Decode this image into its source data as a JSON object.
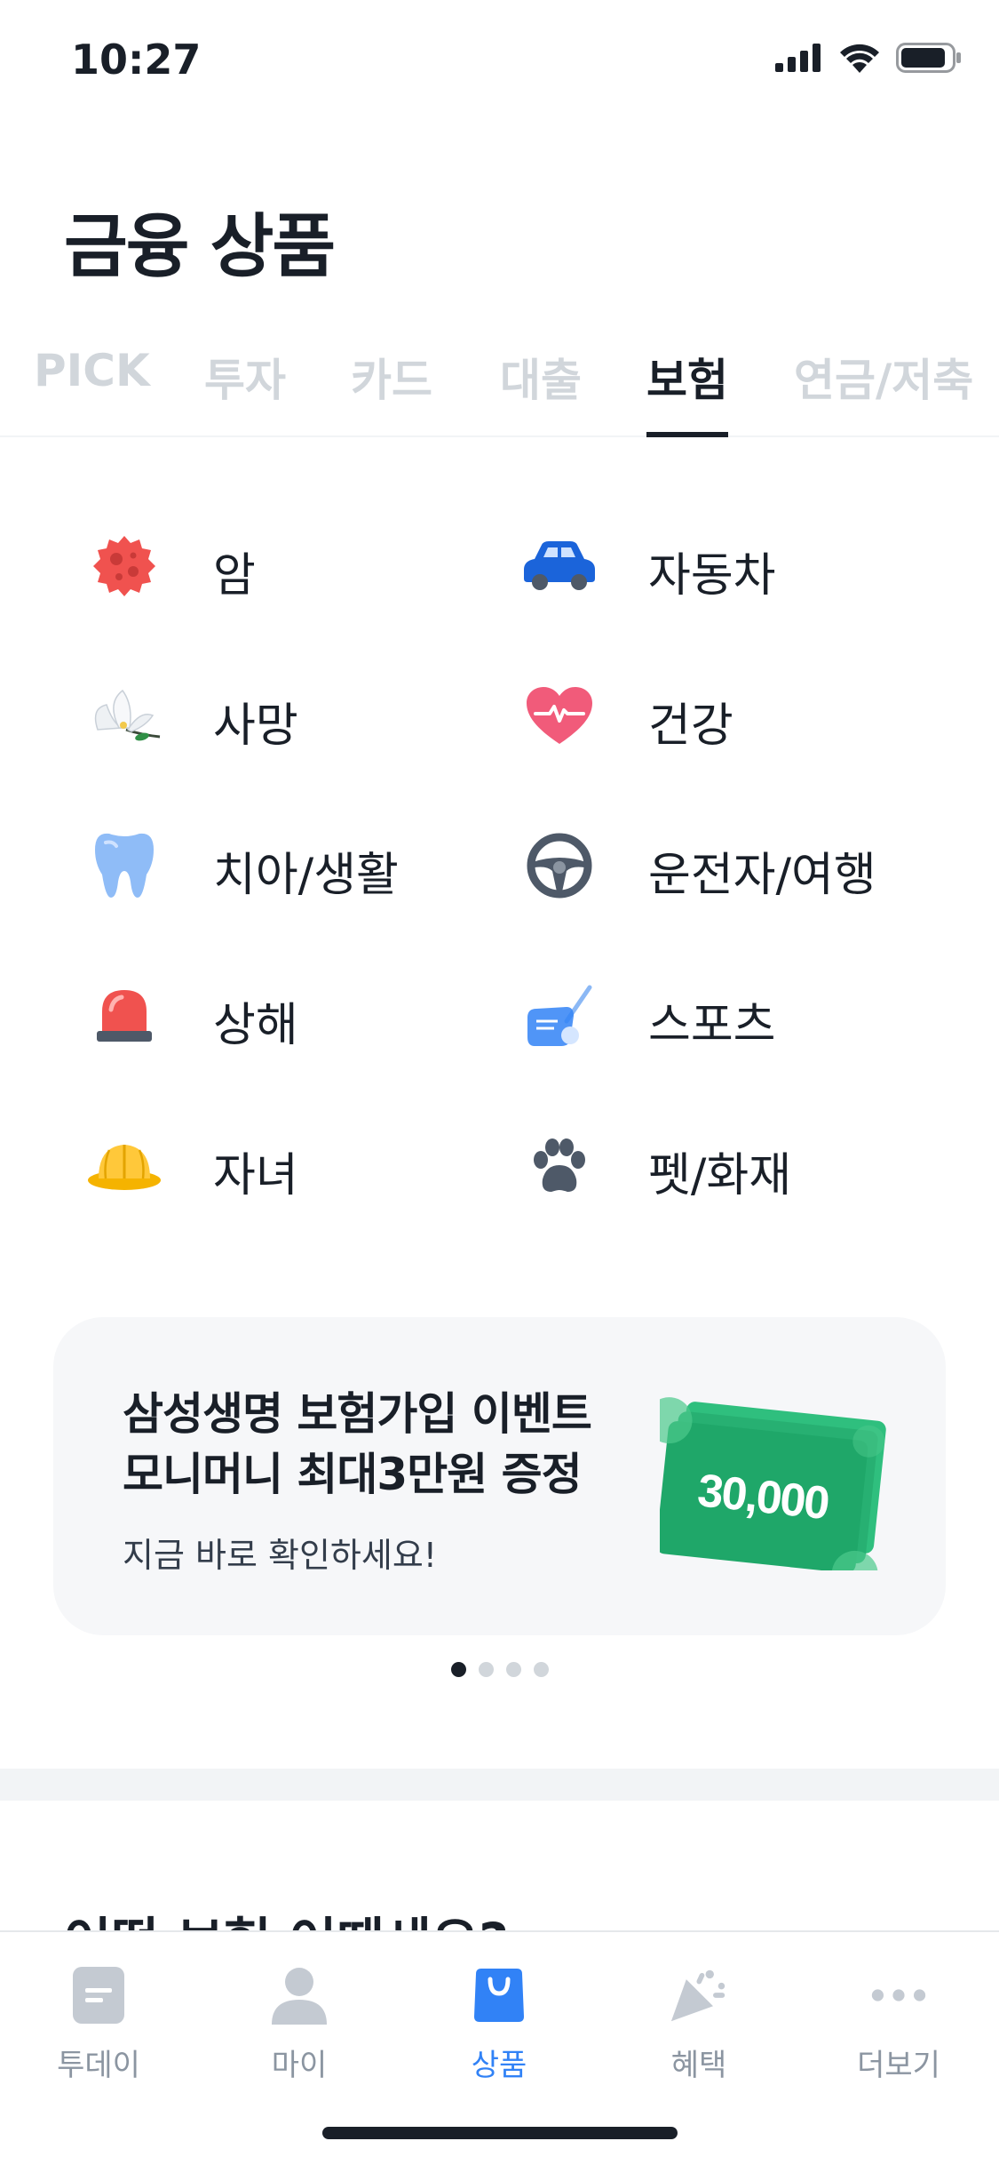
{
  "status": {
    "time": "10:27"
  },
  "page": {
    "title": "금융 상품"
  },
  "tabs": [
    {
      "label": "PICK"
    },
    {
      "label": "투자"
    },
    {
      "label": "카드"
    },
    {
      "label": "대출"
    },
    {
      "label": "보험"
    },
    {
      "label": "연금/저축"
    }
  ],
  "active_tab": "보험",
  "categories": [
    {
      "label": "암",
      "icon": "cancer-cell-icon"
    },
    {
      "label": "자동차",
      "icon": "car-icon"
    },
    {
      "label": "사망",
      "icon": "white-flower-icon"
    },
    {
      "label": "건강",
      "icon": "heartbeat-icon"
    },
    {
      "label": "치아/생활",
      "icon": "tooth-icon"
    },
    {
      "label": "운전자/여행",
      "icon": "steering-wheel-icon"
    },
    {
      "label": "상해",
      "icon": "siren-icon"
    },
    {
      "label": "스포츠",
      "icon": "golf-club-icon"
    },
    {
      "label": "자녀",
      "icon": "kids-hat-icon"
    },
    {
      "label": "펫/화재",
      "icon": "paw-icon"
    }
  ],
  "banner": {
    "title_line1": "삼성생명 보험가입 이벤트",
    "title_line2": "모니머니 최대3만원 증정",
    "subtitle": "지금 바로 확인하세요!",
    "amount": "30,000",
    "dots_total": 4,
    "dots_active": 1
  },
  "next_section": {
    "title": "어떤 보험 어때세요?"
  },
  "tabbar": [
    {
      "label": "투데이",
      "icon": "today-icon"
    },
    {
      "label": "마이",
      "icon": "person-icon"
    },
    {
      "label": "상품",
      "icon": "shopping-bag-icon"
    },
    {
      "label": "혜택",
      "icon": "party-popper-icon"
    },
    {
      "label": "더보기",
      "icon": "more-dots-icon"
    }
  ],
  "colors": {
    "accent": "#3182f6",
    "text": "#191f28",
    "inactive": "#d1d6db",
    "banner_bg": "#f6f7f9",
    "money_green": "#1fa769"
  }
}
